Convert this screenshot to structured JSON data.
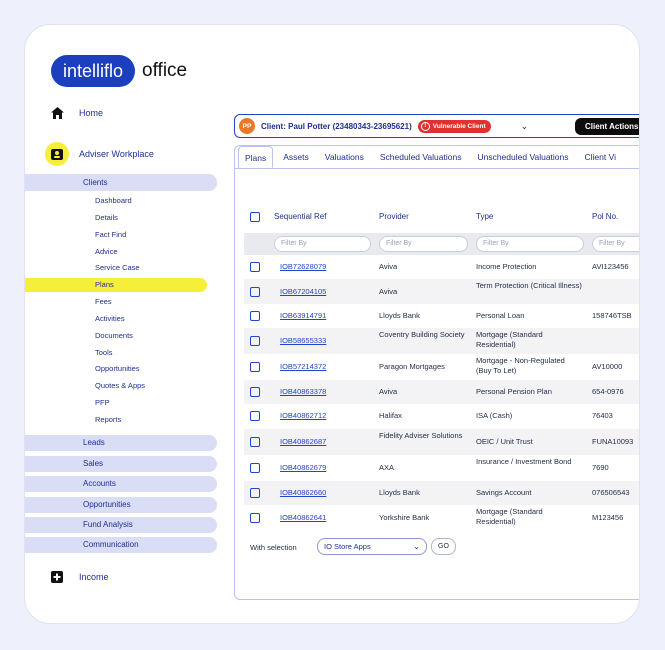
{
  "logo": {
    "brand": "intelliflo",
    "product": "office"
  },
  "nav": {
    "home": "Home",
    "adviser_workplace": "Adviser Workplace",
    "clients": "Clients",
    "client_subitems": [
      "Dashboard",
      "Details",
      "Fact Find",
      "Advice",
      "Service Case",
      "Plans",
      "Fees",
      "Activities",
      "Documents",
      "Tools",
      "Opportunities",
      "Quotes & Apps",
      "PFP",
      "Reports"
    ],
    "groups": [
      "Leads",
      "Sales",
      "Accounts",
      "Opportunities",
      "Fund Analysis",
      "Communication"
    ],
    "income": "Income"
  },
  "client_bar": {
    "initials": "PP",
    "name": "Client: Paul Potter (23480343-23695621)",
    "badge": "Vulnerable Client",
    "actions_label": "Client Actions"
  },
  "tabs": [
    "Plans",
    "Assets",
    "Valuations",
    "Scheduled Valuations",
    "Unscheduled Valuations",
    "Client Vi"
  ],
  "table": {
    "headers": [
      "Sequential Ref",
      "Provider",
      "Type",
      "Pol No."
    ],
    "filter_placeholder": "Filter By",
    "rows": [
      {
        "ref": "IOB72628079",
        "provider": "Aviva",
        "type": "Income Protection",
        "pol": "AVI123456"
      },
      {
        "ref": "IOB67204105",
        "provider": "Aviva",
        "type": "Term Protection (Critical Illness)",
        "pol": ""
      },
      {
        "ref": "IOB63914791",
        "provider": "Lloyds Bank",
        "type": "Personal Loan",
        "pol": "158746TSB"
      },
      {
        "ref": "IOB58655333",
        "provider": "Coventry Building Society",
        "type": "Mortgage (Standard Residential)",
        "pol": ""
      },
      {
        "ref": "IOB57214372",
        "provider": "Paragon Mortgages",
        "type": "Mortgage - Non-Regulated (Buy To Let)",
        "pol": "AV10000"
      },
      {
        "ref": "IOB40863378",
        "provider": "Aviva",
        "type": "Personal Pension Plan",
        "pol": "654-0976"
      },
      {
        "ref": "IOB40862712",
        "provider": "Halifax",
        "type": "ISA (Cash)",
        "pol": "76403"
      },
      {
        "ref": "IOB40862687",
        "provider": "Fidelity Adviser Solutions",
        "type": "OEIC / Unit Trust",
        "pol": "FUNA10093"
      },
      {
        "ref": "IOB40862679",
        "provider": "AXA",
        "type": "Insurance / Investment Bond",
        "pol": "7690"
      },
      {
        "ref": "IOB40862660",
        "provider": "Lloyds Bank",
        "type": "Savings Account",
        "pol": "076506543"
      },
      {
        "ref": "IOB40862641",
        "provider": "Yorkshire Bank",
        "type": "Mortgage (Standard Residential)",
        "pol": "M123456"
      }
    ]
  },
  "footer": {
    "with_selection": "With selection",
    "select_value": "IO Store Apps",
    "go": "GO"
  }
}
